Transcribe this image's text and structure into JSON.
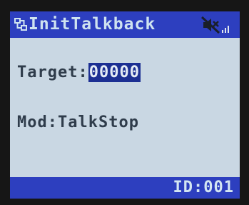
{
  "header": {
    "title": "InitTalkback",
    "icons": [
      "network-icon",
      "mute-icon",
      "signal-icon"
    ]
  },
  "main": {
    "target_label": "Target:",
    "target_value": "00000",
    "mode_text": "Mod:TalkStop"
  },
  "footer": {
    "id_text": "ID:001"
  },
  "colors": {
    "screen_bg": "#c9d7e3",
    "bar_bg": "#2d3fbf",
    "text": "#2f3c4b",
    "highlight_bg": "#1c2f93",
    "highlight_text": "#e5ecf5",
    "bar_text": "#cfe3f0"
  }
}
